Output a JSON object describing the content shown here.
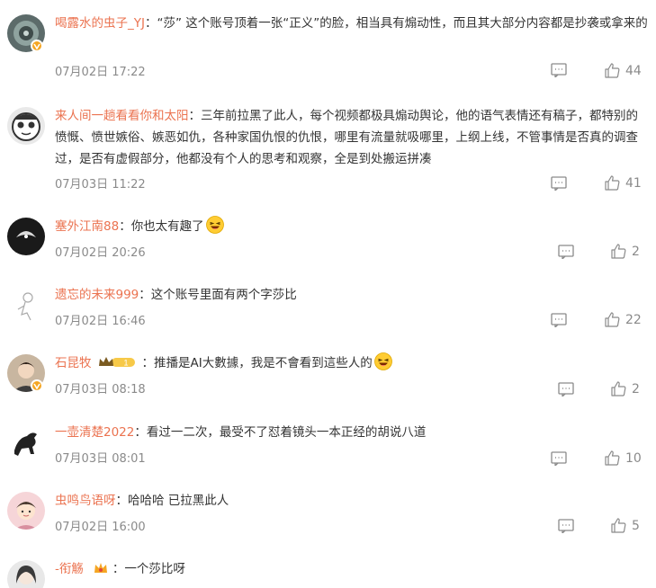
{
  "comments": [
    {
      "username": "喝露水的虫子_YJ",
      "separator": "：",
      "text": "“莎” 这个账号顶着一张“正义”的脸，相当具有煽动性，而且其大部分内容都是抄袭或拿来的",
      "time": "07月02日 17:22",
      "likes": "44"
    },
    {
      "username": "来人间一趟看看你和太阳",
      "separator": "：",
      "text": "三年前拉黑了此人，每个视频都极具煽动舆论，他的语气表情还有稿子，都特别的愤慨、愤世嫉俗、嫉恶如仇，各种家国仇恨的仇恨，哪里有流量就吸哪里，上纲上线，不管事情是否真的调查过，是否有虚假部分，他都没有个人的思考和观察，全是到处搬运拼凑",
      "time": "07月03日 11:22",
      "likes": "41"
    },
    {
      "username": "塞外江南88",
      "separator": "：",
      "text": "你也太有趣了",
      "time": "07月02日 20:26",
      "likes": "2"
    },
    {
      "username": "遗忘的未来999",
      "separator": "：",
      "text": "这个账号里面有两个字莎比",
      "time": "07月02日 16:46",
      "likes": "22"
    },
    {
      "username": "石昆牧",
      "separator": "：",
      "text": "推播是AI大數據，我是不會看到這些人的",
      "time": "07月03日 08:18",
      "likes": "2",
      "badge_text": "1"
    },
    {
      "username": "一壶清楚2022",
      "separator": "：",
      "text": "看过一二次，最受不了怼着镜头一本正经的胡说八道",
      "time": "07月03日 08:01",
      "likes": "10"
    },
    {
      "username": "虫鸣鸟语呀",
      "separator": "：",
      "text": "哈哈哈 已拉黑此人",
      "time": "07月02日 16:00",
      "likes": "5"
    },
    {
      "username": "-衔觞",
      "separator": "：",
      "text": "一个莎比呀",
      "time": "",
      "likes": ""
    }
  ],
  "colors": {
    "username": "#eb7350",
    "meta": "#8a8a8a",
    "text": "#333333",
    "verified": "#f5a623"
  },
  "icons": {
    "reply": "comment-icon",
    "like": "thumbs-up-icon",
    "verified": "verified-v-icon",
    "laugh": "laughing-emoji-icon"
  }
}
